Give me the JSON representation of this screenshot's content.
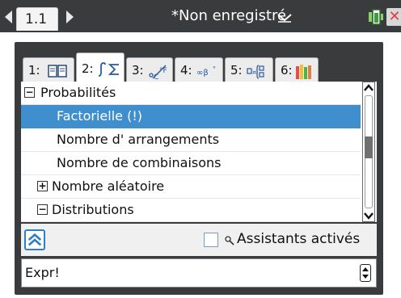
{
  "document": {
    "page_tab_label": "1.1",
    "title": "*Non enregistré",
    "colors": {
      "bar": "#3a3b3c",
      "selection": "#3f8fcf",
      "accent": "#2f7fc4"
    }
  },
  "catalog": {
    "tabs": [
      {
        "label": "1:",
        "icon": "book-icon"
      },
      {
        "label": "2:",
        "icon": "integral-sum-icon"
      },
      {
        "label": "3:",
        "icon": "units-icon"
      },
      {
        "label": "4:",
        "icon": "symbols-icon"
      },
      {
        "label": "5:",
        "icon": "templates-icon"
      },
      {
        "label": "6:",
        "icon": "libraries-icon"
      }
    ],
    "active_tab_index": 1,
    "items": [
      {
        "label": "Probabilités",
        "expander": "−",
        "level": 0
      },
      {
        "label": "Factorielle (!)",
        "expander": "",
        "level": 2,
        "selected": true
      },
      {
        "label": "Nombre d' arrangements",
        "expander": "",
        "level": 2
      },
      {
        "label": "Nombre de combinaisons",
        "expander": "",
        "level": 2
      },
      {
        "label": "Nombre aléatoire",
        "expander": "+",
        "level": 1
      },
      {
        "label": "Distributions",
        "expander": "−",
        "level": 1
      }
    ]
  },
  "footer": {
    "wizards_label": "Assistants activés",
    "wizards_checked": false,
    "entry_value": "Expr!"
  }
}
